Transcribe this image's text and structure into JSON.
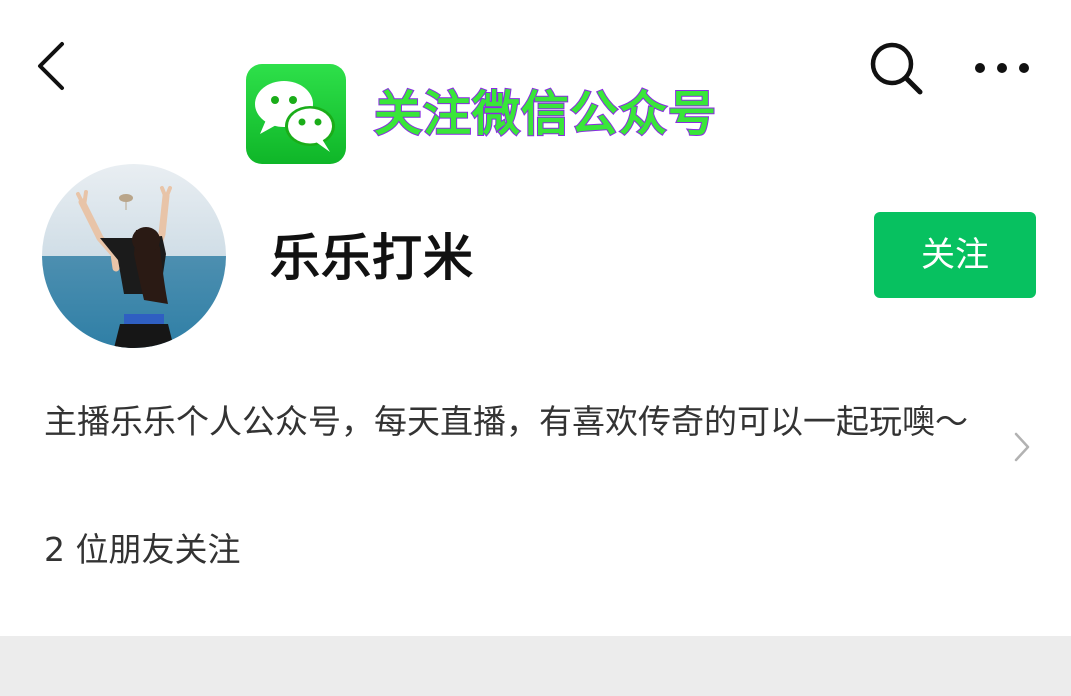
{
  "header": {
    "back_icon": "chevron-left-icon",
    "search_icon": "search-icon",
    "more_icon": "more-horizontal-icon"
  },
  "promo": {
    "logo_icon": "wechat-icon",
    "text": "关注微信公众号",
    "text_color": "#39e639",
    "outline_color": "#8a2be2"
  },
  "profile": {
    "name": "乐乐打米",
    "follow_label": "关注",
    "follow_color": "#07c160",
    "description": "主播乐乐个人公众号，每天直播，有喜欢传奇的可以一起玩噢～",
    "friends_following": "2 位朋友关注"
  }
}
